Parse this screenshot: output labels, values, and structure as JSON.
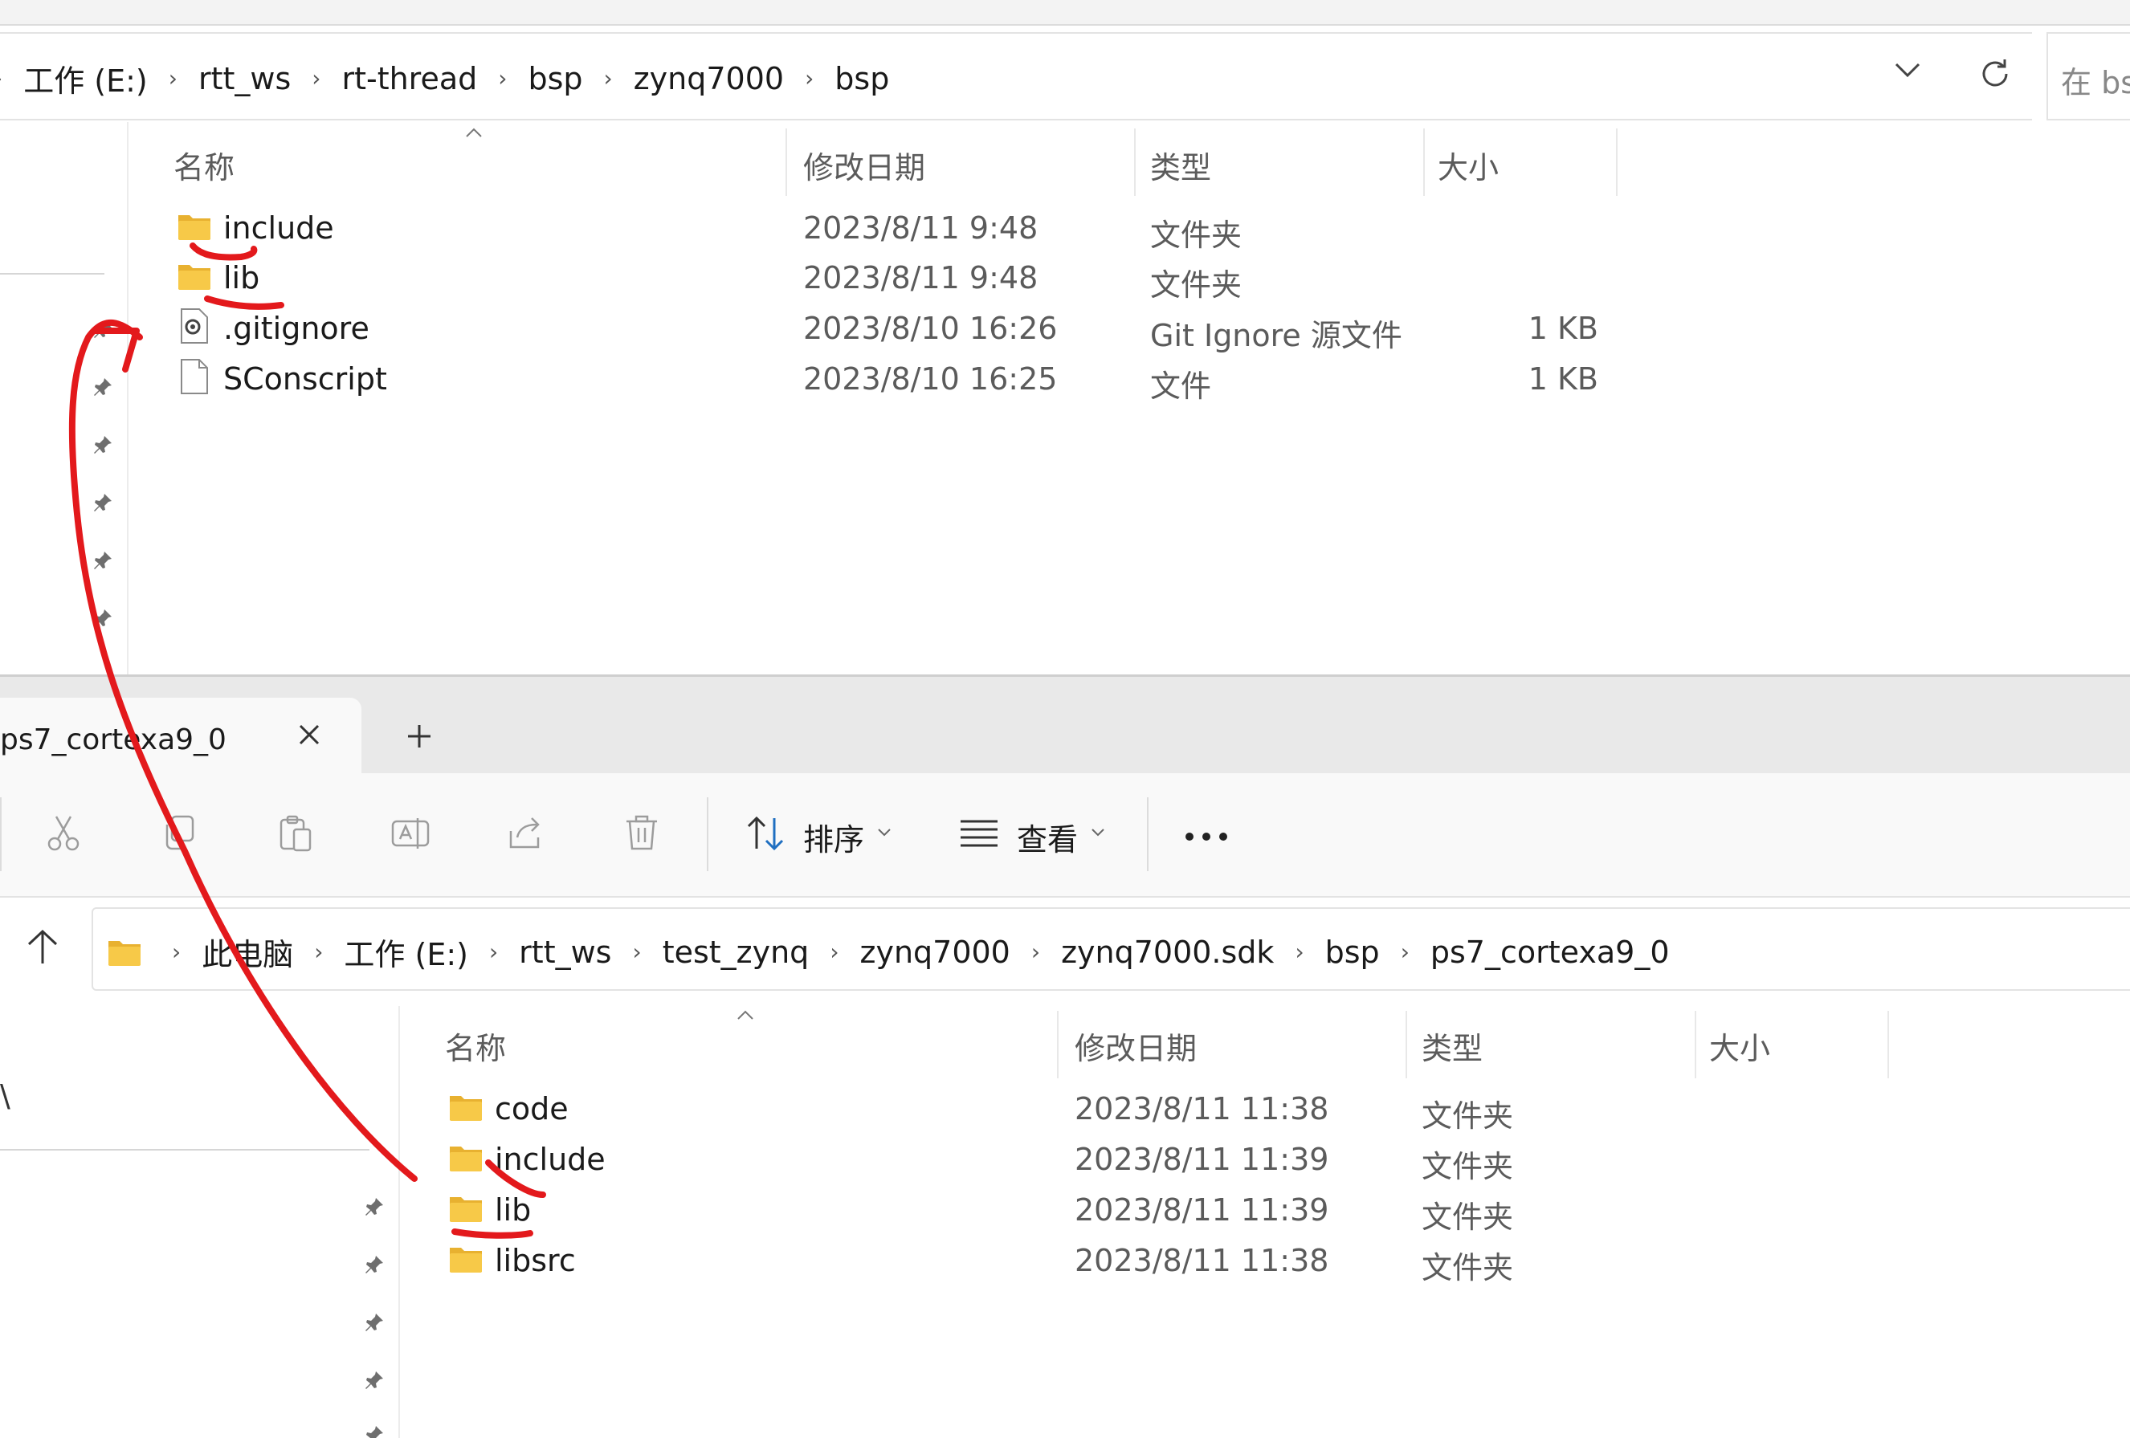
{
  "top_window": {
    "breadcrumb": [
      {
        "label": "工作 (E:)"
      },
      {
        "label": "rtt_ws"
      },
      {
        "label": "rt-thread"
      },
      {
        "label": "bsp"
      },
      {
        "label": "zynq7000"
      },
      {
        "label": "bsp"
      }
    ],
    "search_placeholder": "在 bsp",
    "columns": {
      "name": "名称",
      "modified": "修改日期",
      "type": "类型",
      "size": "大小"
    },
    "files": [
      {
        "name": "include",
        "modified": "2023/8/11 9:48",
        "type": "文件夹",
        "size": "",
        "icon": "folder-icon"
      },
      {
        "name": "lib",
        "modified": "2023/8/11 9:48",
        "type": "文件夹",
        "size": "",
        "icon": "folder-icon"
      },
      {
        "name": ".gitignore",
        "modified": "2023/8/10 16:26",
        "type": "Git Ignore 源文件",
        "size": "1 KB",
        "icon": "settings-file-icon"
      },
      {
        "name": "SConscript",
        "modified": "2023/8/10 16:25",
        "type": "文件",
        "size": "1 KB",
        "icon": "file-icon"
      }
    ]
  },
  "bottom_window": {
    "tab": {
      "title": "ps7_cortexa9_0"
    },
    "toolbar": {
      "sort_label": "排序",
      "view_label": "查看"
    },
    "breadcrumb": [
      {
        "label": "此电脑"
      },
      {
        "label": "工作 (E:)"
      },
      {
        "label": "rtt_ws"
      },
      {
        "label": "test_zynq"
      },
      {
        "label": "zynq7000"
      },
      {
        "label": "zynq7000.sdk"
      },
      {
        "label": "bsp"
      },
      {
        "label": "ps7_cortexa9_0"
      }
    ],
    "columns": {
      "name": "名称",
      "modified": "修改日期",
      "type": "类型",
      "size": "大小"
    },
    "files": [
      {
        "name": "code",
        "modified": "2023/8/11 11:38",
        "type": "文件夹",
        "icon": "folder-icon"
      },
      {
        "name": "include",
        "modified": "2023/8/11 11:39",
        "type": "文件夹",
        "icon": "folder-icon"
      },
      {
        "name": "lib",
        "modified": "2023/8/11 11:39",
        "type": "文件夹",
        "icon": "folder-icon"
      },
      {
        "name": "libsrc",
        "modified": "2023/8/11 11:38",
        "type": "文件夹",
        "icon": "folder-icon"
      }
    ]
  },
  "colors": {
    "annotation_red": "#e3191c",
    "folder_yellow": "#f7c948"
  }
}
